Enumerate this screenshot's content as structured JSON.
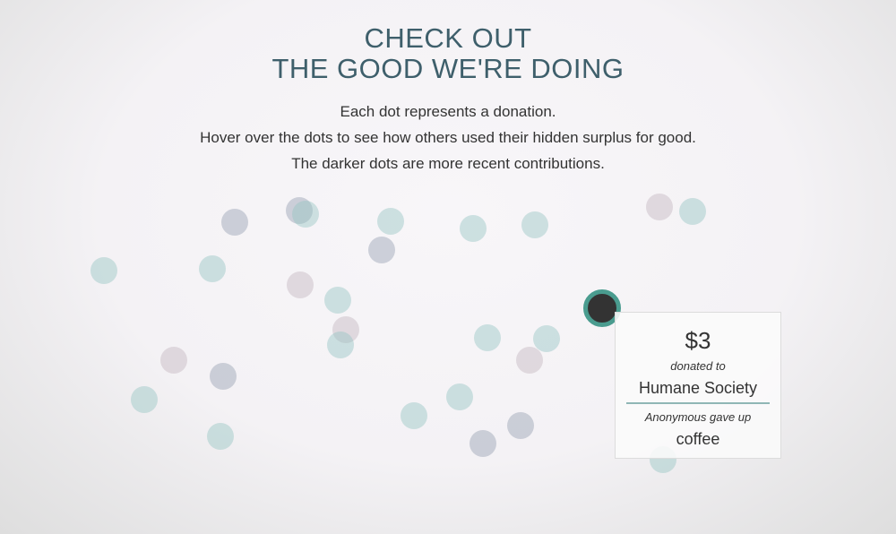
{
  "headline": {
    "line1": "CHECK OUT",
    "line2": "THE GOOD WE'RE DOING"
  },
  "intro": {
    "line1": "Each dot represents a donation.",
    "line2": "Hover over the dots to see how others used their hidden surplus for good.",
    "line3": "The darker dots are more recent contributions."
  },
  "tooltip": {
    "amount": "$3",
    "donated_to_label": "donated to",
    "organization": "Humane Society",
    "giver": "Anonymous gave up",
    "item": "coffee"
  },
  "colors": {
    "heading": "#3e5f6b",
    "active_dot_ring": "#4a9c8f",
    "active_dot_fill": "#333333",
    "teal_dot": "#96c6c4",
    "slate_dot": "#8c96aa",
    "mauve_dot": "#beafb9"
  }
}
